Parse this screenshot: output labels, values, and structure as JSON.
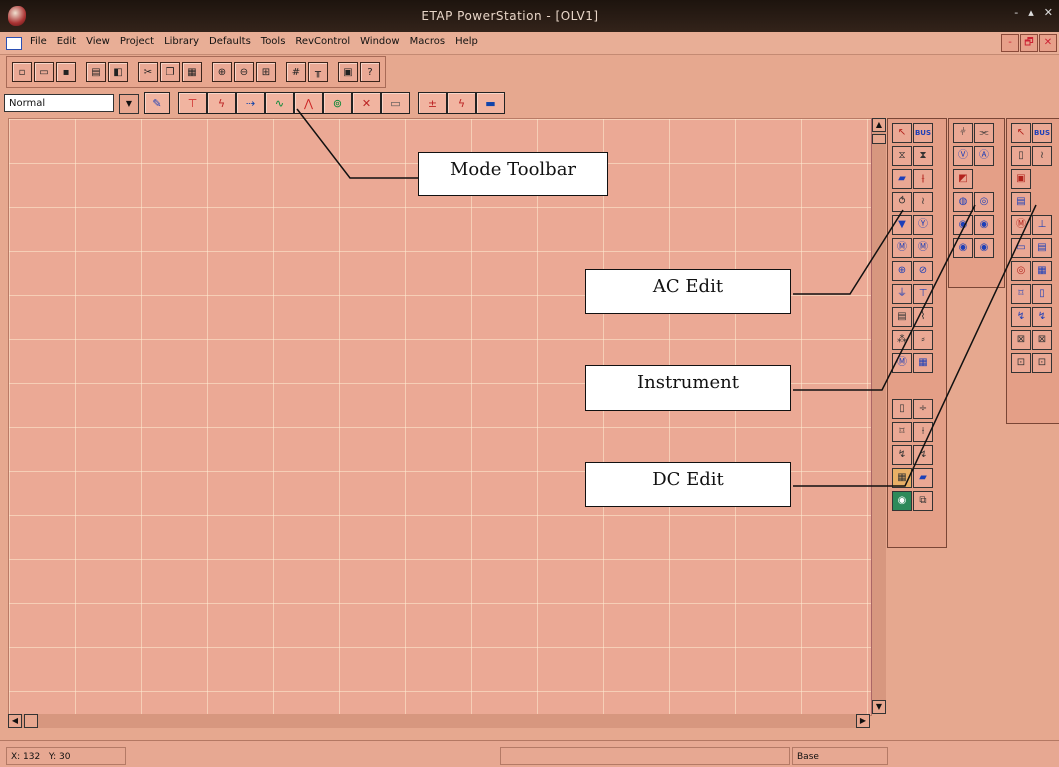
{
  "window": {
    "title": "ETAP PowerStation - [OLV1]",
    "controls": [
      "-",
      "▴",
      "✕"
    ]
  },
  "menu": {
    "items": [
      "File",
      "Edit",
      "View",
      "Project",
      "Library",
      "Defaults",
      "Tools",
      "RevControl",
      "Window",
      "Macros",
      "Help"
    ],
    "mdi_controls": [
      "-",
      "🗗",
      "✕"
    ]
  },
  "toolbar": {
    "mode_value": "Normal"
  },
  "callouts": {
    "mode_toolbar": "Mode Toolbar",
    "ac_edit": "AC Edit",
    "instrument": "Instrument",
    "dc_edit": "DC Edit"
  },
  "palettes": {
    "ac_edit_bus_label": "BUS",
    "dc_edit_bus_label": "BUS"
  },
  "statusbar": {
    "x_label": "X: 132",
    "y_label": "Y: 30",
    "config": "Base"
  }
}
